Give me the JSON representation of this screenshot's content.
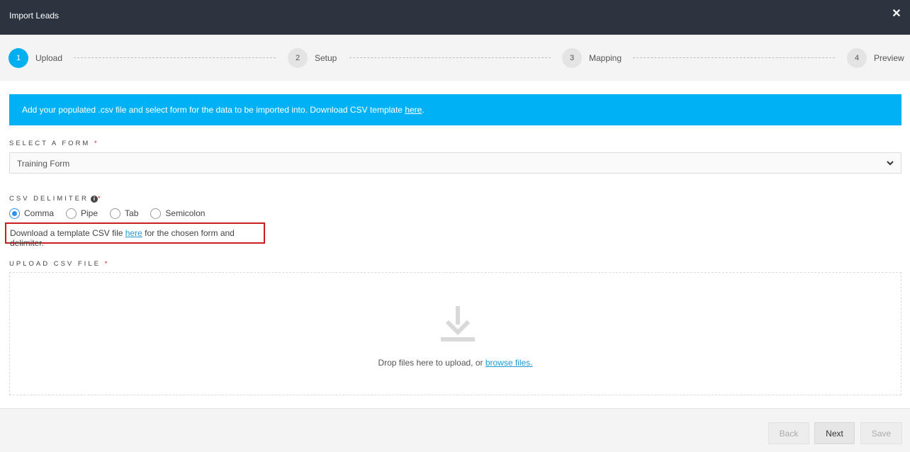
{
  "window": {
    "title": "Import Leads"
  },
  "steps": [
    {
      "num": "1",
      "label": "Upload",
      "active": true
    },
    {
      "num": "2",
      "label": "Setup",
      "active": false
    },
    {
      "num": "3",
      "label": "Mapping",
      "active": false
    },
    {
      "num": "4",
      "label": "Preview",
      "active": false
    }
  ],
  "info": {
    "text": "Add your populated .csv file and select form for the data to be imported into. Download CSV template ",
    "link": "here",
    "suffix": "."
  },
  "form_select": {
    "label": "SELECT A FORM",
    "required_mark": "*",
    "value": "Training Form"
  },
  "delimiter": {
    "label": "CSV DELIMITER",
    "info_icon": "i",
    "required_mark": "*",
    "options": [
      "Comma",
      "Pipe",
      "Tab",
      "Semicolon"
    ],
    "selected": "Comma"
  },
  "template_note": {
    "prefix": "Download a template CSV file ",
    "link": "here",
    "suffix": " for the chosen form and delimiter."
  },
  "upload": {
    "label": "UPLOAD CSV FILE",
    "required_mark": "*",
    "drop_text": "Drop files here to upload, or ",
    "browse_link": "browse files."
  },
  "footer": {
    "back_label": "Back",
    "next_label": "Next",
    "save_label": "Save"
  },
  "colors": {
    "titlebar": "#2c3440",
    "accent": "#00b2f5",
    "required": "#e02020",
    "highlight_box": "#c81e1e"
  }
}
